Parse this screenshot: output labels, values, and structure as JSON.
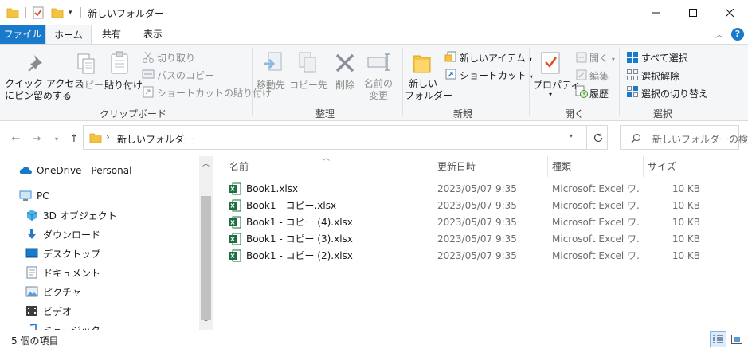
{
  "window": {
    "title": "新しいフォルダー",
    "minimize": "—",
    "maximize": "☐",
    "close": "✕"
  },
  "tabs": {
    "file": "ファイル",
    "home": "ホーム",
    "share": "共有",
    "view": "表示"
  },
  "ribbon": {
    "clipboard": {
      "label": "クリップボード",
      "pin_line1": "クイック アクセス",
      "pin_line2": "にピン留めする",
      "copy": "コピー",
      "paste": "貼り付け",
      "cut": "切り取り",
      "copy_path": "パスのコピー",
      "paste_shortcut": "ショートカットの貼り付け"
    },
    "organize": {
      "label": "整理",
      "move_to": "移動先",
      "copy_to": "コピー先",
      "delete": "削除",
      "rename_line1": "名前の",
      "rename_line2": "変更"
    },
    "new": {
      "label": "新規",
      "new_folder_line1": "新しい",
      "new_folder_line2": "フォルダー",
      "new_item": "新しいアイテム",
      "shortcut": "ショートカット"
    },
    "open": {
      "label": "開く",
      "properties": "プロパティ",
      "open": "開く",
      "edit": "編集",
      "history": "履歴"
    },
    "select": {
      "label": "選択",
      "select_all": "すべて選択",
      "select_none": "選択解除",
      "invert": "選択の切り替え"
    }
  },
  "address": {
    "separator": "›",
    "path": "新しいフォルダー",
    "search_placeholder": "新しいフォルダーの検..."
  },
  "nav": {
    "items": [
      {
        "label": "OneDrive - Personal",
        "icon": "onedrive-icon"
      },
      {
        "label": "PC",
        "icon": "pc-icon"
      },
      {
        "label": "3D オブジェクト",
        "icon": "3d-objects-icon"
      },
      {
        "label": "ダウンロード",
        "icon": "download-icon"
      },
      {
        "label": "デスクトップ",
        "icon": "desktop-icon"
      },
      {
        "label": "ドキュメント",
        "icon": "documents-icon"
      },
      {
        "label": "ピクチャ",
        "icon": "pictures-icon"
      },
      {
        "label": "ビデオ",
        "icon": "videos-icon"
      },
      {
        "label": "ミュージック",
        "icon": "music-icon"
      }
    ]
  },
  "columns": {
    "name": "名前",
    "date": "更新日時",
    "type": "種類",
    "size": "サイズ"
  },
  "files": [
    {
      "name": "Book1.xlsx",
      "date": "2023/05/07 9:35",
      "type": "Microsoft Excel ワ...",
      "size": "10 KB"
    },
    {
      "name": "Book1 - コピー.xlsx",
      "date": "2023/05/07 9:35",
      "type": "Microsoft Excel ワ...",
      "size": "10 KB"
    },
    {
      "name": "Book1 - コピー (4).xlsx",
      "date": "2023/05/07 9:35",
      "type": "Microsoft Excel ワ...",
      "size": "10 KB"
    },
    {
      "name": "Book1 - コピー (3).xlsx",
      "date": "2023/05/07 9:35",
      "type": "Microsoft Excel ワ...",
      "size": "10 KB"
    },
    {
      "name": "Book1 - コピー (2).xlsx",
      "date": "2023/05/07 9:35",
      "type": "Microsoft Excel ワ...",
      "size": "10 KB"
    }
  ],
  "status": {
    "item_count": "5 個の項目"
  },
  "colors": {
    "accent": "#1979ca",
    "folder": "#f5c342",
    "excel": "#1d6f42"
  }
}
